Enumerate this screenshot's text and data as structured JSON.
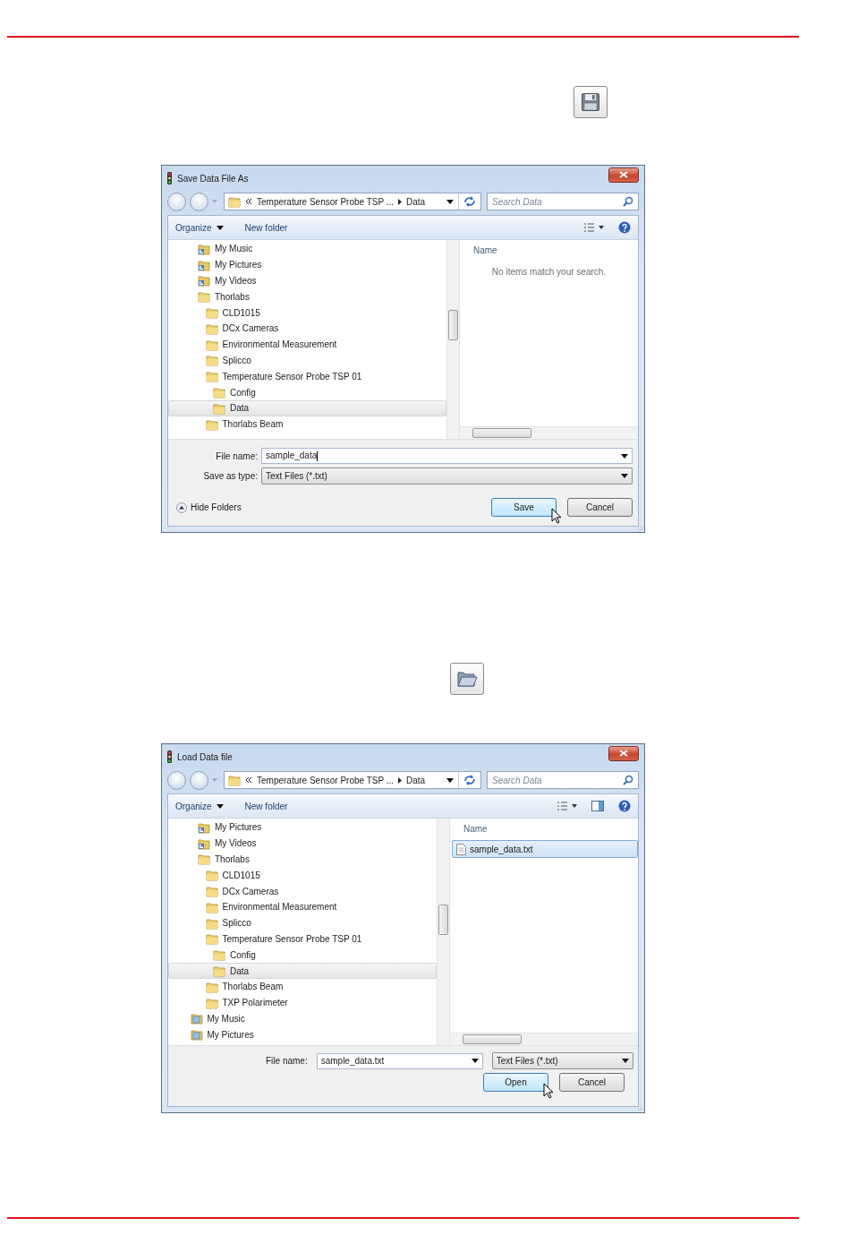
{
  "dialogs": [
    {
      "tool_icon": {
        "kind": "save"
      },
      "kind": "save",
      "title": "Save Data File As",
      "path": [
        "Temperature Sensor Probe TSP ...",
        "Data"
      ],
      "search": {
        "placeholder": "Search Data"
      },
      "toolbar": [
        {
          "label": "Organize",
          "kind": "menu"
        },
        {
          "label": "New folder",
          "kind": "plain"
        }
      ],
      "tree": [
        {
          "children": [
            {
              "label": "My Music",
              "kind": "shortcut",
              "selected": false
            },
            {
              "label": "My Pictures",
              "kind": "shortcut",
              "selected": false
            },
            {
              "label": "My Videos",
              "kind": "shortcut",
              "selected": false
            },
            {
              "label": "Thorlabs",
              "kind": "folder",
              "selected": false,
              "children": [
                {
                  "label": "CLD1015",
                  "kind": "folder",
                  "selected": false
                },
                {
                  "label": "DCx Cameras",
                  "kind": "folder",
                  "selected": false
                },
                {
                  "label": "Environmental Measurement",
                  "kind": "folder",
                  "selected": false
                },
                {
                  "label": "Splicco",
                  "kind": "folder",
                  "selected": false
                },
                {
                  "label": "Temperature Sensor Probe TSP 01",
                  "kind": "folder",
                  "selected": false,
                  "children": [
                    {
                      "label": "Config",
                      "kind": "folder",
                      "selected": false
                    },
                    {
                      "label": "Data",
                      "kind": "folder",
                      "selected": true
                    }
                  ]
                },
                {
                  "label": "Thorlabs Beam",
                  "kind": "folder",
                  "selected": false
                }
              ]
            }
          ]
        }
      ],
      "column": "Name",
      "empty_message": "No items match your search.",
      "file_name": {
        "label": "File name:",
        "value": "sample_data",
        "focused": true
      },
      "file_type": {
        "label": "Save as type:",
        "value": "Text Files (*.txt)"
      },
      "hide_folders": "Hide Folders",
      "buttons": [
        {
          "label": "Save",
          "kind": "primary",
          "hovered": true
        },
        {
          "label": "Cancel",
          "kind": "default",
          "hovered": false
        }
      ]
    },
    {
      "tool_icon": {
        "kind": "open"
      },
      "kind": "open",
      "title": "Load Data file",
      "path": [
        "Temperature Sensor Probe TSP ...",
        "Data"
      ],
      "search": {
        "placeholder": "Search Data"
      },
      "toolbar": [
        {
          "label": "Organize",
          "kind": "menu"
        },
        {
          "label": "New folder",
          "kind": "plain"
        }
      ],
      "tree": [
        {
          "children": [
            {
              "label": "My Pictures",
              "kind": "shortcut",
              "selected": false
            },
            {
              "label": "My Videos",
              "kind": "shortcut",
              "selected": false
            },
            {
              "label": "Thorlabs",
              "kind": "folder",
              "selected": false,
              "children": [
                {
                  "label": "CLD1015",
                  "kind": "folder",
                  "selected": false
                },
                {
                  "label": "DCx Cameras",
                  "kind": "folder",
                  "selected": false
                },
                {
                  "label": "Environmental Measurement",
                  "kind": "folder",
                  "selected": false
                },
                {
                  "label": "Splicco",
                  "kind": "folder",
                  "selected": false
                },
                {
                  "label": "Temperature Sensor Probe TSP 01",
                  "kind": "folder",
                  "selected": false,
                  "children": [
                    {
                      "label": "Config",
                      "kind": "folder",
                      "selected": false
                    },
                    {
                      "label": "Data",
                      "kind": "folder",
                      "selected": true
                    }
                  ]
                },
                {
                  "label": "Thorlabs Beam",
                  "kind": "folder",
                  "selected": false
                },
                {
                  "label": "TXP Polarimeter",
                  "kind": "folder",
                  "selected": false
                }
              ]
            }
          ]
        },
        {
          "label": "My Music",
          "kind": "library",
          "selected": false
        },
        {
          "label": "My Pictures",
          "kind": "library",
          "selected": false
        }
      ],
      "column": "Name",
      "files": [
        {
          "name": "sample_data.txt",
          "selected": true
        }
      ],
      "file_name": {
        "label": "File name:",
        "value": "sample_data.txt",
        "focused": false
      },
      "file_type": {
        "value": "Text Files (*.txt)"
      },
      "buttons": [
        {
          "label": "Open",
          "kind": "primary",
          "hovered": true
        },
        {
          "label": "Cancel",
          "kind": "default",
          "hovered": false
        }
      ]
    }
  ]
}
